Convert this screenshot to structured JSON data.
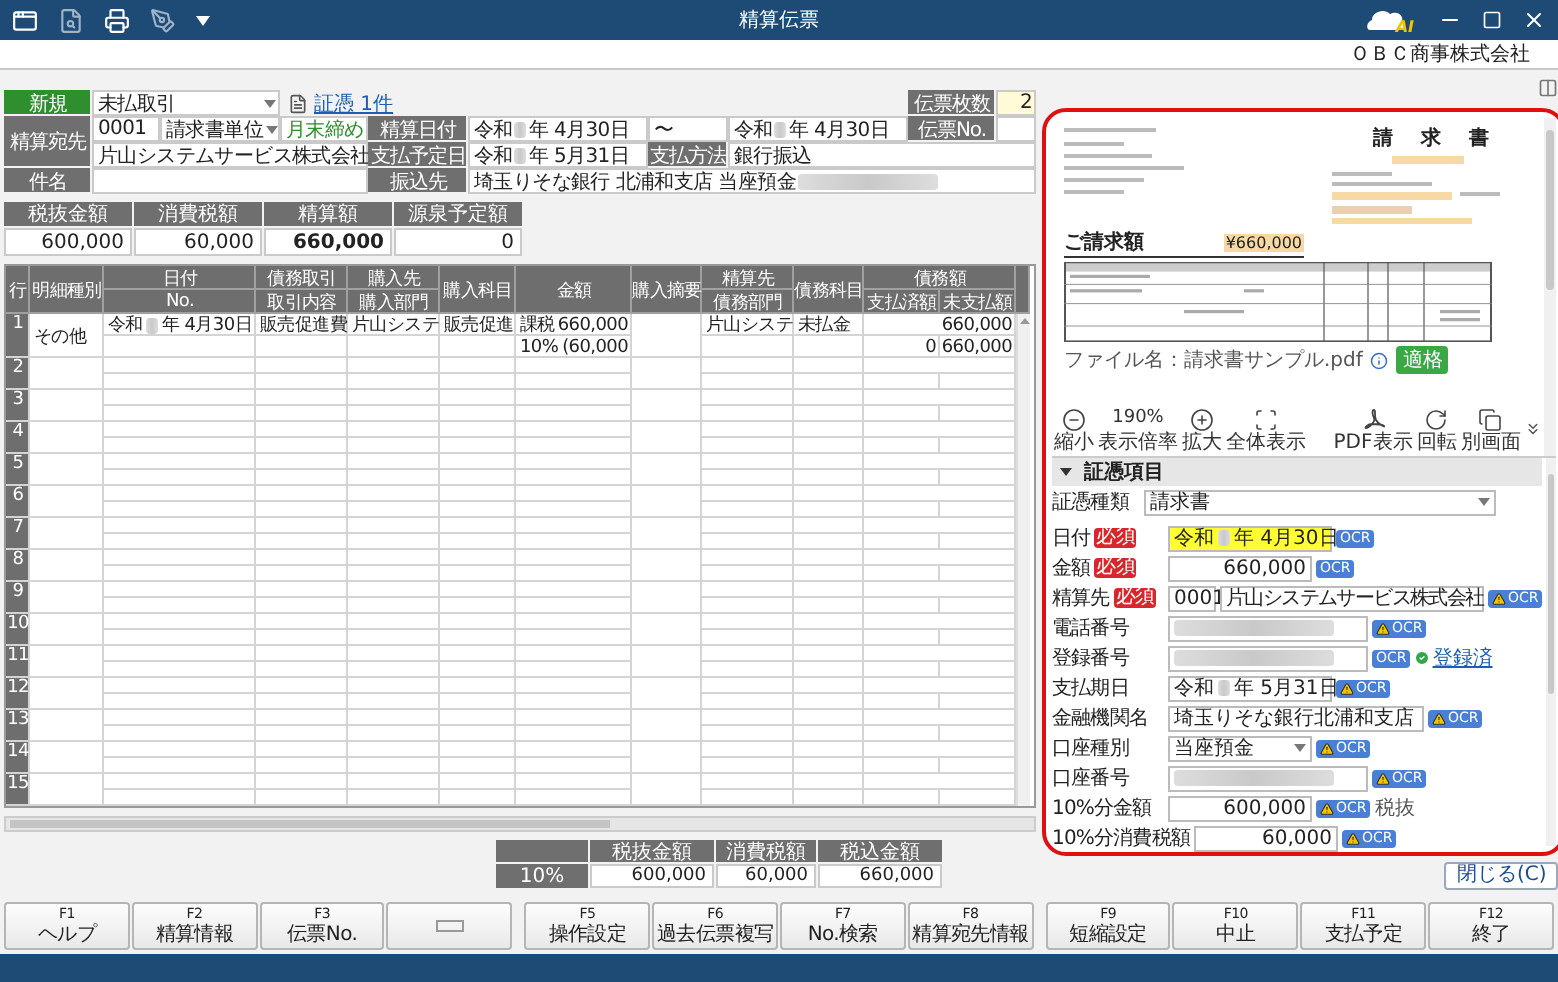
{
  "window": {
    "title": "精算伝票",
    "logo_text": "AI",
    "company": "ＯＢＣ商事株式会社"
  },
  "header": {
    "mode": "新規",
    "trade_type": "未払取引",
    "evidence_link": "証憑 1件",
    "slip_count_label": "伝票枚数",
    "slip_count": "2",
    "payee_label": "精算宛先",
    "payee_code": "0001",
    "billing_unit": "請求書単位",
    "closing": "月末締め",
    "payee_name": "片山システムサービス株式会社",
    "subject_label": "件名",
    "date_label": "精算日付",
    "date_from": {
      "era": "令和",
      "rest": "年 4月30日"
    },
    "tilde": "〜",
    "date_to": {
      "era": "令和",
      "rest": "年 4月30日"
    },
    "slip_no_label": "伝票No.",
    "pay_date_label": "支払予定日",
    "pay_date": {
      "era": "令和",
      "rest": "年 5月31日"
    },
    "method_label": "支払方法",
    "method": "銀行振込",
    "bank_label": "振込先",
    "bank": "埼玉りそな銀行 北浦和支店 当座預金"
  },
  "summary": [
    {
      "label": "税抜金額",
      "value": "600,000",
      "bold": false
    },
    {
      "label": "消費税額",
      "value": "60,000",
      "bold": false
    },
    {
      "label": "精算額",
      "value": "660,000",
      "bold": true
    },
    {
      "label": "源泉予定額",
      "value": "0",
      "bold": false
    }
  ],
  "grid": {
    "headers": {
      "row": "行",
      "kind": "明細種別",
      "date": "日付",
      "no": "No.",
      "trade": "債務取引",
      "content": "取引内容",
      "vendor": "購入先",
      "vendor_dept": "購入部門",
      "vendor_account": "購入科目",
      "amount": "金額",
      "vendor_memo": "購入摘要",
      "payee": "精算先",
      "debt_dept": "債務部門",
      "debt_account": "債務科目",
      "debt_amount": "債務額",
      "paid": "支払済額",
      "unpaid": "未支払額"
    },
    "rows": [
      {
        "number": "1",
        "kind": "その他",
        "era": "令和",
        "date": "年 4月30日",
        "content": "販売促進費",
        "vendor": "片山システ",
        "account": "販売促進",
        "tax_type": "課税",
        "amount": "660,000",
        "rate": "10%",
        "tax": "(60,000",
        "payee": "片山システ",
        "debt_account": "未払金",
        "debt_amount": "660,000",
        "paid": "0",
        "unpaid": "660,000"
      },
      {
        "number": "2"
      },
      {
        "number": "3"
      },
      {
        "number": "4"
      },
      {
        "number": "5"
      },
      {
        "number": "6"
      },
      {
        "number": "7"
      },
      {
        "number": "8"
      },
      {
        "number": "9"
      },
      {
        "number": "10"
      },
      {
        "number": "11"
      },
      {
        "number": "12"
      },
      {
        "number": "13"
      },
      {
        "number": "14"
      },
      {
        "number": "15"
      }
    ]
  },
  "tax_summary": {
    "columns": [
      "税抜金額",
      "消費税額",
      "税込金額"
    ],
    "rows": [
      {
        "rate": "10%",
        "values": [
          "600,000",
          "60,000",
          "660,000"
        ]
      }
    ]
  },
  "close_button": "閉じる(C)",
  "preview": {
    "title": "請　求　書",
    "total_label": "ご請求額",
    "total": "¥660,000",
    "file_name": "ファイル名：請求書サンプル.pdf",
    "tag": "適格",
    "zoom": "190%",
    "tools": [
      {
        "kind": "zoom_out",
        "label": "縮小"
      },
      {
        "kind": "zoom_level",
        "label": "表示倍率"
      },
      {
        "kind": "zoom_in",
        "label": "拡大"
      },
      {
        "kind": "fit",
        "label": "全体表示"
      },
      {
        "kind": "pdf",
        "label": "PDF表示"
      },
      {
        "kind": "rotate",
        "label": "回転"
      },
      {
        "kind": "window",
        "label": "別画面"
      }
    ]
  },
  "evidence": {
    "section": "証憑項目",
    "expanded": true,
    "type_label": "証憑種類",
    "type": "請求書",
    "fields": [
      {
        "label": "日付",
        "badge": "必須",
        "kind": "date",
        "era": "令和",
        "value": "年 4月30日",
        "highlighted": true,
        "ocr": "OCR",
        "warning": false
      },
      {
        "label": "金額",
        "badge": "必須",
        "kind": "amount",
        "value": "660,000",
        "ocr": "OCR",
        "warning": false
      },
      {
        "label": "精算先",
        "badge": "必須",
        "kind": "code_name",
        "code": "0001",
        "value": "片山システムサービス株式会社",
        "ocr": "OCR",
        "warning": true
      },
      {
        "label": "電話番号",
        "kind": "blurred",
        "ocr": "OCR",
        "warning": true
      },
      {
        "label": "登録番号",
        "kind": "blurred",
        "ocr": "OCR",
        "warning": false,
        "status": "登録済"
      },
      {
        "label": "支払期日",
        "kind": "date",
        "era": "令和",
        "value": "年 5月31日",
        "highlighted": false,
        "ocr": "OCR",
        "warning": true
      },
      {
        "label": "金融機関名",
        "kind": "text",
        "value": "埼玉りそな銀行北浦和支店",
        "ocr": "OCR",
        "warning": true
      },
      {
        "label": "口座種別",
        "kind": "select",
        "value": "当座預金",
        "ocr": "OCR",
        "warning": true
      },
      {
        "label": "口座番号",
        "kind": "blurred",
        "ocr": "OCR",
        "warning": true
      },
      {
        "label": "10%分金額",
        "kind": "amount",
        "value": "600,000",
        "ocr": "OCR",
        "warning": true,
        "note": "税抜"
      },
      {
        "label": "10%分消費税額",
        "kind": "amount",
        "value": "60,000",
        "ocr": "OCR",
        "warning": true
      }
    ]
  },
  "function_keys": [
    {
      "kind": "key",
      "key": "F1",
      "label": "ヘルプ"
    },
    {
      "kind": "key",
      "key": "F2",
      "label": "精算情報"
    },
    {
      "kind": "key",
      "key": "F3",
      "label": "伝票No."
    },
    {
      "kind": "blank"
    },
    {
      "kind": "key",
      "key": "F5",
      "label": "操作設定"
    },
    {
      "kind": "key",
      "key": "F6",
      "label": "過去伝票複写"
    },
    {
      "kind": "key",
      "key": "F7",
      "label": "No.検索"
    },
    {
      "kind": "key",
      "key": "F8",
      "label": "精算宛先情報"
    },
    {
      "kind": "key",
      "key": "F9",
      "label": "短縮設定"
    },
    {
      "kind": "key",
      "key": "F10",
      "label": "中止"
    },
    {
      "kind": "key",
      "key": "F11",
      "label": "支払予定"
    },
    {
      "kind": "key",
      "key": "F12",
      "label": "終了"
    }
  ]
}
